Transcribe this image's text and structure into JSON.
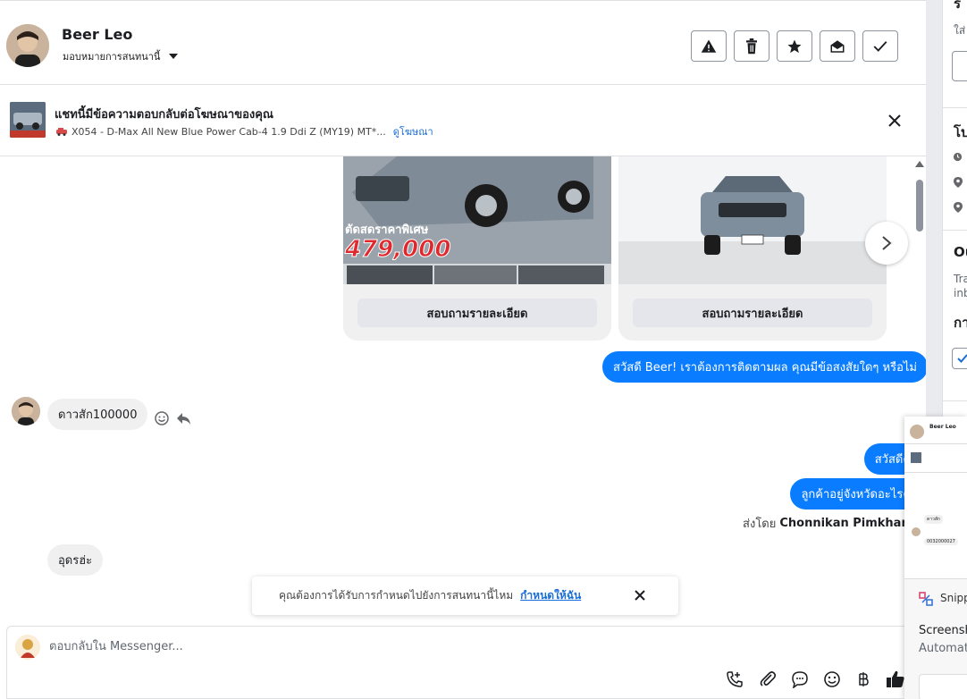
{
  "header": {
    "contact_name": "Beer Leo",
    "assign_label": "มอบหมายการสนทนานี้",
    "actions": [
      "warning-icon",
      "trash-icon",
      "star-icon",
      "envelope-open-icon",
      "check-icon"
    ]
  },
  "ad_banner": {
    "title": "แชทนี้มีข้อความตอบกลับต่อโฆษณาของคุณ",
    "subtitle": "X054 - D-Max All New Blue Power Cab-4 1.9 Ddi Z (MY19) MT*...",
    "link": "ดูโฆษณา"
  },
  "cards": [
    {
      "price_banner": "ตัดสดราคาพิเศษ",
      "price": "479,000",
      "button": "สอบถามรายละเอียด"
    },
    {
      "button": "สอบถามรายละเอียด"
    }
  ],
  "messages": {
    "greeting_out": "สวัสดี Beer! เราต้องการติดตามผล คุณมีข้อสงสัยใดๆ หรือไม่",
    "reply_in_1": "ดาวสัก100000",
    "reply_out_1": "สวัสดีคะ",
    "reply_out_2": "ลูกค้าอยู่จังหวัดอะไรคะ",
    "sent_by_prefix": "ส่งโดย",
    "sent_by_name": "Chonnikan Pimkham",
    "reply_in_2": "อุดรฮ่ะ"
  },
  "toast": {
    "text": "คุณต้องการได้รับการกำหนดไปยังการสนทนานี้ไหม",
    "link": "กำหนดให้ฉัน"
  },
  "composer": {
    "placeholder": "ตอบกลับใน Messenger..."
  },
  "right_panel": {
    "frag_1": "ร",
    "frag_2": "ใส่",
    "frag_3": "โป",
    "frag_4": "Ou",
    "frag_5": "Tra",
    "frag_6": "inb",
    "frag_7": "กา"
  },
  "snip": {
    "preview_name": "Beer Leo",
    "preview_msg_1": "ดาวสัก",
    "preview_msg_2": "0032000027",
    "app": "Snipp",
    "line1": "Screensh",
    "line2": "Automat"
  },
  "colors": {
    "accent": "#0a7cff",
    "link": "#1a6ed8",
    "bubble_in": "#f0f0f0",
    "border": "#dddfe2"
  }
}
